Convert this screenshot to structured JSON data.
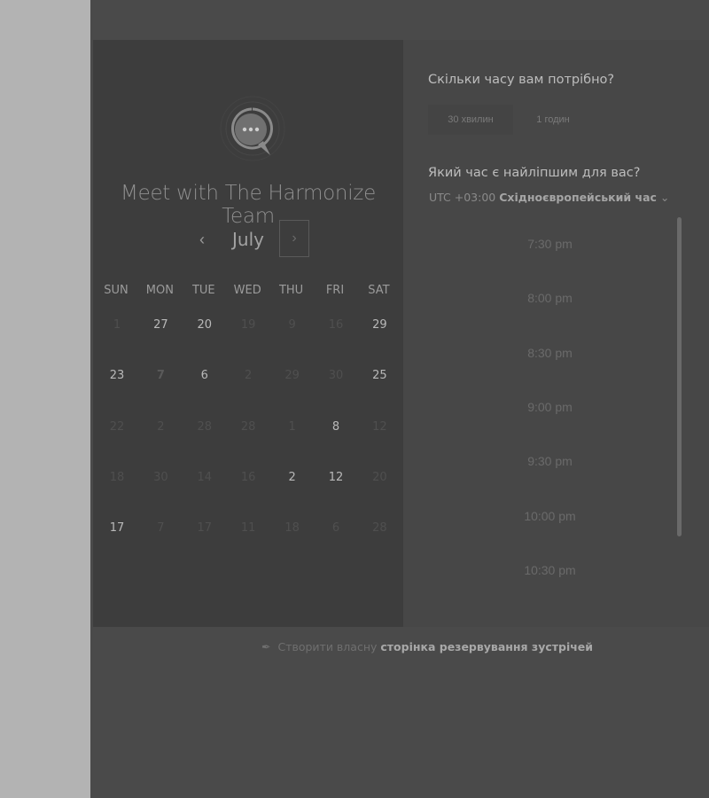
{
  "scheduler": {
    "title": "Meet with The Harmonize Team",
    "logo_icon": "chat-bubble-icon",
    "month": "July",
    "prev_icon": "‹",
    "next_icon": "›",
    "weekdays": [
      "SUN",
      "MON",
      "TUE",
      "WED",
      "THU",
      "FRI",
      "SAT"
    ],
    "weeks": [
      [
        {
          "d": "1",
          "a": false
        },
        {
          "d": "27",
          "a": true
        },
        {
          "d": "20",
          "a": true
        },
        {
          "d": "19",
          "a": false
        },
        {
          "d": "9",
          "a": false
        },
        {
          "d": "16",
          "a": false
        },
        {
          "d": "29",
          "a": true
        }
      ],
      [
        {
          "d": "23",
          "a": true
        },
        {
          "d": "7",
          "a": true,
          "sel": true
        },
        {
          "d": "6",
          "a": true
        },
        {
          "d": "2",
          "a": false
        },
        {
          "d": "29",
          "a": false
        },
        {
          "d": "30",
          "a": false
        },
        {
          "d": "25",
          "a": true
        }
      ],
      [
        {
          "d": "22",
          "a": false
        },
        {
          "d": "2",
          "a": false
        },
        {
          "d": "28",
          "a": false
        },
        {
          "d": "28",
          "a": false
        },
        {
          "d": "1",
          "a": false
        },
        {
          "d": "8",
          "a": true
        },
        {
          "d": "12",
          "a": false
        }
      ],
      [
        {
          "d": "18",
          "a": false
        },
        {
          "d": "30",
          "a": false
        },
        {
          "d": "14",
          "a": false
        },
        {
          "d": "16",
          "a": false
        },
        {
          "d": "2",
          "a": true
        },
        {
          "d": "12",
          "a": true
        },
        {
          "d": "20",
          "a": false
        }
      ],
      [
        {
          "d": "17",
          "a": true
        },
        {
          "d": "7",
          "a": false
        },
        {
          "d": "17",
          "a": false
        },
        {
          "d": "11",
          "a": false
        },
        {
          "d": "18",
          "a": false
        },
        {
          "d": "6",
          "a": false
        },
        {
          "d": "28",
          "a": false
        }
      ]
    ]
  },
  "booking": {
    "duration_question": "Скільки часу вам потрібно?",
    "durations": [
      "30 хвилин",
      "1 годин"
    ],
    "time_question": "Який час є найліпшим для вас?",
    "timezone_offset": "UTC +03:00",
    "timezone_name": "Східноєвропейський час",
    "timezone_caret": "⌄",
    "slots": [
      "7:30 pm",
      "8:00 pm",
      "8:30 pm",
      "9:00 pm",
      "9:30 pm",
      "10:00 pm",
      "10:30 pm"
    ]
  },
  "footer": {
    "icon": "calendar-icon",
    "icon_glyph": "🗓",
    "text_prefix": "Створити власну",
    "text_link": "сторінка резервування зустрічей"
  }
}
